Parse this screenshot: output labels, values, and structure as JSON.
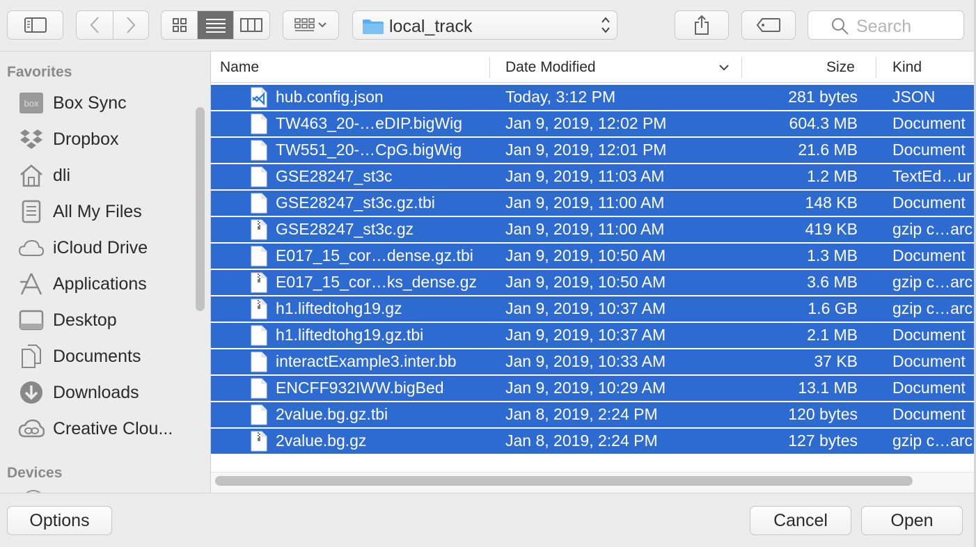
{
  "toolbar": {
    "location": "local_track",
    "search_placeholder": "Search"
  },
  "sidebar": {
    "sections": [
      {
        "title": "Favorites"
      },
      {
        "title": "Devices"
      }
    ],
    "items": [
      {
        "label": "Box Sync",
        "icon": "box-icon"
      },
      {
        "label": "Dropbox",
        "icon": "dropbox-icon"
      },
      {
        "label": "dli",
        "icon": "home-icon"
      },
      {
        "label": "All My Files",
        "icon": "all-files-icon"
      },
      {
        "label": "iCloud Drive",
        "icon": "cloud-icon"
      },
      {
        "label": "Applications",
        "icon": "applications-icon"
      },
      {
        "label": "Desktop",
        "icon": "desktop-icon"
      },
      {
        "label": "Documents",
        "icon": "documents-icon"
      },
      {
        "label": "Downloads",
        "icon": "downloads-icon"
      },
      {
        "label": "Creative Clou...",
        "icon": "creative-cloud-icon"
      }
    ],
    "box_text": "box"
  },
  "columns": {
    "name": "Name",
    "date": "Date Modified",
    "size": "Size",
    "kind": "Kind"
  },
  "files": [
    {
      "name": "hub.config.json",
      "date": "Today, 3:12 PM",
      "size": "281 bytes",
      "kind": "JSON",
      "icon": "json-file-icon"
    },
    {
      "name": "TW463_20-…eDIP.bigWig",
      "date": "Jan 9, 2019, 12:02 PM",
      "size": "604.3 MB",
      "kind": "Document",
      "icon": "document-icon"
    },
    {
      "name": "TW551_20-…CpG.bigWig",
      "date": "Jan 9, 2019, 12:01 PM",
      "size": "21.6 MB",
      "kind": "Document",
      "icon": "document-icon"
    },
    {
      "name": "GSE28247_st3c",
      "date": "Jan 9, 2019, 11:03 AM",
      "size": "1.2 MB",
      "kind": "TextEd…ur",
      "icon": "document-icon"
    },
    {
      "name": "GSE28247_st3c.gz.tbi",
      "date": "Jan 9, 2019, 11:00 AM",
      "size": "148 KB",
      "kind": "Document",
      "icon": "document-icon"
    },
    {
      "name": "GSE28247_st3c.gz",
      "date": "Jan 9, 2019, 11:00 AM",
      "size": "419 KB",
      "kind": "gzip c…arc",
      "icon": "zip-file-icon"
    },
    {
      "name": "E017_15_cor…dense.gz.tbi",
      "date": "Jan 9, 2019, 10:50 AM",
      "size": "1.3 MB",
      "kind": "Document",
      "icon": "document-icon"
    },
    {
      "name": "E017_15_cor…ks_dense.gz",
      "date": "Jan 9, 2019, 10:50 AM",
      "size": "3.6 MB",
      "kind": "gzip c…arc",
      "icon": "zip-file-icon"
    },
    {
      "name": "h1.liftedtohg19.gz",
      "date": "Jan 9, 2019, 10:37 AM",
      "size": "1.6 GB",
      "kind": "gzip c…arc",
      "icon": "zip-file-icon"
    },
    {
      "name": "h1.liftedtohg19.gz.tbi",
      "date": "Jan 9, 2019, 10:37 AM",
      "size": "2.1 MB",
      "kind": "Document",
      "icon": "document-icon"
    },
    {
      "name": "interactExample3.inter.bb",
      "date": "Jan 9, 2019, 10:33 AM",
      "size": "37 KB",
      "kind": "Document",
      "icon": "document-icon"
    },
    {
      "name": "ENCFF932IWW.bigBed",
      "date": "Jan 9, 2019, 10:29 AM",
      "size": "13.1 MB",
      "kind": "Document",
      "icon": "document-icon"
    },
    {
      "name": "2value.bg.gz.tbi",
      "date": "Jan 8, 2019, 2:24 PM",
      "size": "120 bytes",
      "kind": "Document",
      "icon": "document-icon"
    },
    {
      "name": "2value.bg.gz",
      "date": "Jan 8, 2019, 2:24 PM",
      "size": "127 bytes",
      "kind": "gzip c…arc",
      "icon": "zip-file-icon"
    }
  ],
  "buttons": {
    "options": "Options",
    "cancel": "Cancel",
    "open": "Open"
  },
  "colors": {
    "selection": "#2e6bd0",
    "folder": "#5ab0f0"
  }
}
